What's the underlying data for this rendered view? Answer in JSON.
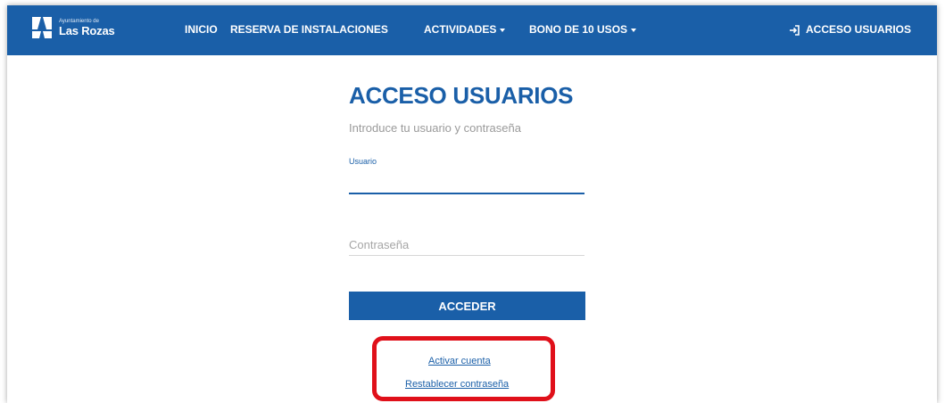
{
  "brand": {
    "small_text": "Ayuntamiento de",
    "big_text": "Las Rozas"
  },
  "nav": {
    "items": [
      {
        "label": "INICIO"
      },
      {
        "label": "RESERVA DE INSTALACIONES"
      },
      {
        "label": "ACTIVIDADES"
      },
      {
        "label": "BONO DE 10 USOS"
      }
    ],
    "login_label": "ACCESO USUARIOS",
    "login_icon": "login-icon"
  },
  "login": {
    "title": "ACCESO USUARIOS",
    "subtitle": "Introduce tu usuario y contraseña",
    "usuario_label": "Usuario",
    "usuario_value": "",
    "password_placeholder": "Contraseña",
    "submit_label": "ACCEDER",
    "link_activar": "Activar cuenta",
    "link_restablecer": "Restablecer contraseña"
  },
  "colors": {
    "primary": "#1a5fa8",
    "highlight": "#e0101a"
  }
}
